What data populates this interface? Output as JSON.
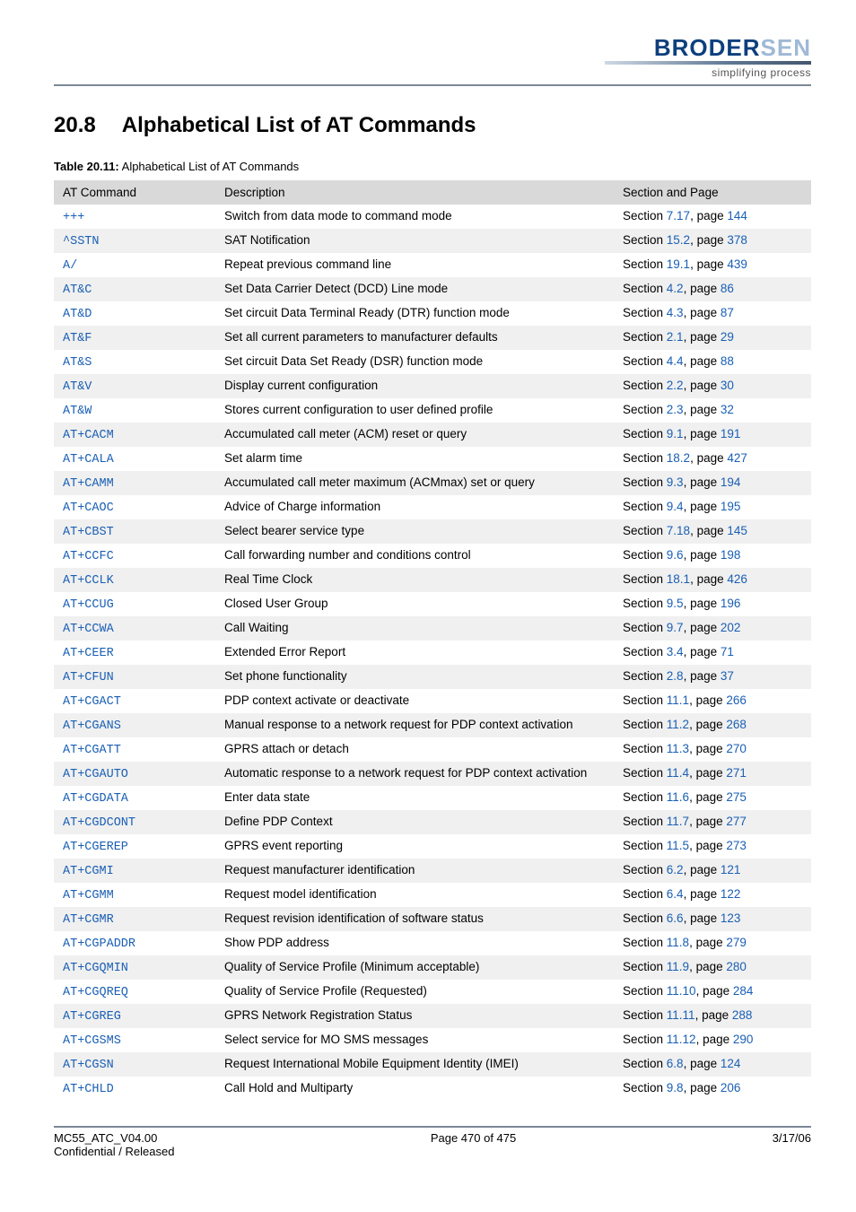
{
  "logo": {
    "main_a": "BRODER",
    "main_b": "SEN",
    "tagline": "simplifying process"
  },
  "heading": {
    "number": "20.8",
    "title": "Alphabetical List of AT Commands"
  },
  "table_caption": {
    "label": "Table 20.11:",
    "text": " Alphabetical List of AT Commands"
  },
  "columns": {
    "c1": "AT Command",
    "c2": "Description",
    "c3": "Section and Page"
  },
  "rows": [
    {
      "cmd": "+++",
      "desc": "Switch from data mode to command mode",
      "sec_prefix": "Section ",
      "sec": "7.17",
      "mid": ", page ",
      "page": "144"
    },
    {
      "cmd": "^SSTN",
      "desc": "SAT Notification",
      "sec_prefix": "Section ",
      "sec": "15.2",
      "mid": ", page ",
      "page": "378"
    },
    {
      "cmd": "A/",
      "desc": "Repeat previous command line",
      "sec_prefix": "Section ",
      "sec": "19.1",
      "mid": ", page ",
      "page": "439"
    },
    {
      "cmd": "AT&C",
      "desc": "Set Data Carrier Detect (DCD) Line mode",
      "sec_prefix": "Section ",
      "sec": "4.2",
      "mid": ", page ",
      "page": "86"
    },
    {
      "cmd": "AT&D",
      "desc": "Set circuit Data Terminal Ready (DTR) function mode",
      "sec_prefix": "Section ",
      "sec": "4.3",
      "mid": ", page ",
      "page": "87"
    },
    {
      "cmd": "AT&F",
      "desc": "Set all current parameters to manufacturer defaults",
      "sec_prefix": "Section ",
      "sec": "2.1",
      "mid": ", page ",
      "page": "29"
    },
    {
      "cmd": "AT&S",
      "desc": "Set circuit Data Set Ready (DSR) function mode",
      "sec_prefix": "Section ",
      "sec": "4.4",
      "mid": ", page ",
      "page": "88"
    },
    {
      "cmd": "AT&V",
      "desc": "Display current configuration",
      "sec_prefix": "Section ",
      "sec": "2.2",
      "mid": ", page ",
      "page": "30"
    },
    {
      "cmd": "AT&W",
      "desc": "Stores current configuration to user defined profile",
      "sec_prefix": "Section ",
      "sec": "2.3",
      "mid": ", page ",
      "page": "32"
    },
    {
      "cmd": "AT+CACM",
      "desc": "Accumulated call meter (ACM) reset or query",
      "sec_prefix": "Section ",
      "sec": "9.1",
      "mid": ", page ",
      "page": "191"
    },
    {
      "cmd": "AT+CALA",
      "desc": "Set alarm time",
      "sec_prefix": "Section ",
      "sec": "18.2",
      "mid": ", page ",
      "page": "427"
    },
    {
      "cmd": "AT+CAMM",
      "desc": "Accumulated call meter maximum (ACMmax) set or query",
      "sec_prefix": "Section ",
      "sec": "9.3",
      "mid": ", page ",
      "page": "194"
    },
    {
      "cmd": "AT+CAOC",
      "desc": "Advice of Charge information",
      "sec_prefix": "Section ",
      "sec": "9.4",
      "mid": ", page ",
      "page": "195"
    },
    {
      "cmd": "AT+CBST",
      "desc": "Select bearer service type",
      "sec_prefix": "Section ",
      "sec": "7.18",
      "mid": ", page ",
      "page": "145"
    },
    {
      "cmd": "AT+CCFC",
      "desc": "Call forwarding number and conditions control",
      "sec_prefix": "Section ",
      "sec": "9.6",
      "mid": ", page ",
      "page": "198"
    },
    {
      "cmd": "AT+CCLK",
      "desc": "Real Time Clock",
      "sec_prefix": "Section ",
      "sec": "18.1",
      "mid": ", page ",
      "page": "426"
    },
    {
      "cmd": "AT+CCUG",
      "desc": "Closed User Group",
      "sec_prefix": "Section ",
      "sec": "9.5",
      "mid": ", page ",
      "page": "196"
    },
    {
      "cmd": "AT+CCWA",
      "desc": "Call Waiting",
      "sec_prefix": "Section ",
      "sec": "9.7",
      "mid": ", page ",
      "page": "202"
    },
    {
      "cmd": "AT+CEER",
      "desc": "Extended Error Report",
      "sec_prefix": "Section ",
      "sec": "3.4",
      "mid": ", page ",
      "page": "71"
    },
    {
      "cmd": "AT+CFUN",
      "desc": "Set phone functionality",
      "sec_prefix": "Section ",
      "sec": "2.8",
      "mid": ", page ",
      "page": "37"
    },
    {
      "cmd": "AT+CGACT",
      "desc": "PDP context activate or deactivate",
      "sec_prefix": "Section ",
      "sec": "11.1",
      "mid": ", page ",
      "page": "266"
    },
    {
      "cmd": "AT+CGANS",
      "desc": "Manual response to a network request for PDP context activation",
      "sec_prefix": "Section ",
      "sec": "11.2",
      "mid": ", page ",
      "page": "268"
    },
    {
      "cmd": "AT+CGATT",
      "desc": "GPRS attach or detach",
      "sec_prefix": "Section ",
      "sec": "11.3",
      "mid": ", page ",
      "page": "270"
    },
    {
      "cmd": "AT+CGAUTO",
      "desc": "Automatic response to a network request for PDP context activation",
      "sec_prefix": "Section ",
      "sec": "11.4",
      "mid": ", page ",
      "page": "271"
    },
    {
      "cmd": "AT+CGDATA",
      "desc": "Enter data state",
      "sec_prefix": "Section ",
      "sec": "11.6",
      "mid": ", page ",
      "page": "275"
    },
    {
      "cmd": "AT+CGDCONT",
      "desc": "Define PDP Context",
      "sec_prefix": "Section ",
      "sec": "11.7",
      "mid": ", page ",
      "page": "277"
    },
    {
      "cmd": "AT+CGEREP",
      "desc": "GPRS event reporting",
      "sec_prefix": "Section ",
      "sec": "11.5",
      "mid": ", page ",
      "page": "273"
    },
    {
      "cmd": "AT+CGMI",
      "desc": "Request manufacturer identification",
      "sec_prefix": "Section ",
      "sec": "6.2",
      "mid": ", page ",
      "page": "121"
    },
    {
      "cmd": "AT+CGMM",
      "desc": "Request model identification",
      "sec_prefix": "Section ",
      "sec": "6.4",
      "mid": ", page ",
      "page": "122"
    },
    {
      "cmd": "AT+CGMR",
      "desc": "Request revision identification of software status",
      "sec_prefix": "Section ",
      "sec": "6.6",
      "mid": ", page ",
      "page": "123"
    },
    {
      "cmd": "AT+CGPADDR",
      "desc": "Show PDP address",
      "sec_prefix": "Section ",
      "sec": "11.8",
      "mid": ", page ",
      "page": "279"
    },
    {
      "cmd": "AT+CGQMIN",
      "desc": "Quality of Service Profile (Minimum acceptable)",
      "sec_prefix": "Section ",
      "sec": "11.9",
      "mid": ", page ",
      "page": "280"
    },
    {
      "cmd": "AT+CGQREQ",
      "desc": "Quality of Service Profile (Requested)",
      "sec_prefix": "Section ",
      "sec": "11.10",
      "mid": ", page ",
      "page": "284"
    },
    {
      "cmd": "AT+CGREG",
      "desc": "GPRS Network Registration Status",
      "sec_prefix": "Section ",
      "sec": "11.11",
      "mid": ", page ",
      "page": "288"
    },
    {
      "cmd": "AT+CGSMS",
      "desc": "Select service for MO SMS messages",
      "sec_prefix": "Section ",
      "sec": "11.12",
      "mid": ", page ",
      "page": "290"
    },
    {
      "cmd": "AT+CGSN",
      "desc": "Request International Mobile Equipment Identity (IMEI)",
      "sec_prefix": "Section ",
      "sec": "6.8",
      "mid": ", page ",
      "page": "124"
    },
    {
      "cmd": "AT+CHLD",
      "desc": "Call Hold and Multiparty",
      "sec_prefix": "Section ",
      "sec": "9.8",
      "mid": ", page ",
      "page": "206"
    }
  ],
  "footer": {
    "left1": "MC55_ATC_V04.00",
    "left2": "Confidential / Released",
    "center": "Page 470 of 475",
    "right": "3/17/06"
  }
}
